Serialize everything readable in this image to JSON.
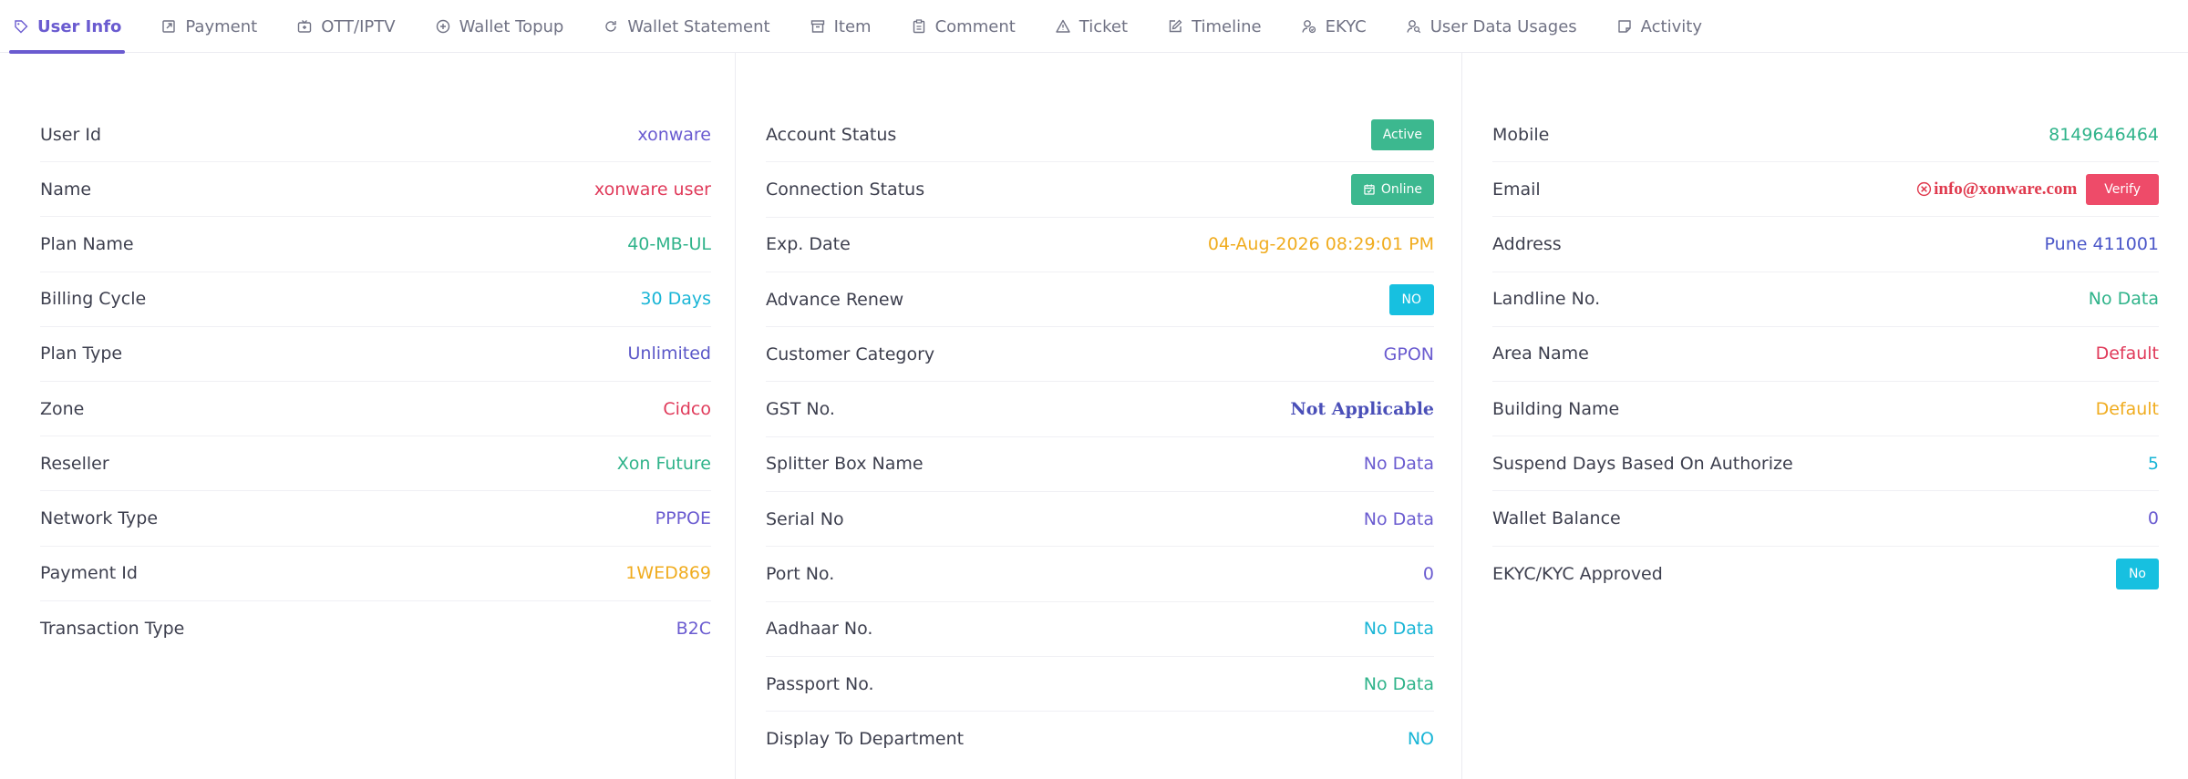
{
  "tabs": [
    {
      "label": "User Info",
      "icon": "tag-icon",
      "active": true
    },
    {
      "label": "Payment",
      "icon": "external-link-icon"
    },
    {
      "label": "OTT/IPTV",
      "icon": "tv-icon"
    },
    {
      "label": "Wallet Topup",
      "icon": "plus-circle-icon"
    },
    {
      "label": "Wallet Statement",
      "icon": "refresh-icon"
    },
    {
      "label": "Item",
      "icon": "archive-icon"
    },
    {
      "label": "Comment",
      "icon": "clipboard-icon"
    },
    {
      "label": "Ticket",
      "icon": "alert-triangle-icon"
    },
    {
      "label": "Timeline",
      "icon": "edit-icon"
    },
    {
      "label": "EKYC",
      "icon": "user-check-icon"
    },
    {
      "label": "User Data Usages",
      "icon": "user-search-icon"
    },
    {
      "label": "Activity",
      "icon": "note-icon"
    }
  ],
  "col1": [
    {
      "label": "User Id",
      "value": "xonware",
      "color": "#6a5bd0"
    },
    {
      "label": "Name",
      "value": "xonware user",
      "color": "#e03a5a"
    },
    {
      "label": "Plan Name",
      "value": "40-MB-UL",
      "color": "#2fb38a"
    },
    {
      "label": "Billing Cycle",
      "value": "30 Days",
      "color": "#19b5d6"
    },
    {
      "label": "Plan Type",
      "value": "Unlimited",
      "color": "#5b57c8"
    },
    {
      "label": "Zone",
      "value": "Cidco",
      "color": "#e03a5a"
    },
    {
      "label": "Reseller",
      "value": "Xon Future",
      "color": "#2fb38a"
    },
    {
      "label": "Network Type",
      "value": "PPPOE",
      "color": "#6a5bd0"
    },
    {
      "label": "Payment Id",
      "value": "1WED869",
      "color": "#f0ac1f"
    },
    {
      "label": "Transaction Type",
      "value": "B2C",
      "color": "#6a5bd0"
    }
  ],
  "col2": [
    {
      "label": "Account Status",
      "badge": "Active",
      "badge_class": "green"
    },
    {
      "label": "Connection Status",
      "badge": "Online",
      "badge_class": "green",
      "badge_icon": "calendar-check-icon"
    },
    {
      "label": "Exp. Date",
      "value": "04-Aug-2026 08:29:01 PM",
      "color": "#f0ac1f"
    },
    {
      "label": "Advance Renew",
      "badge": "NO",
      "badge_class": "cyan"
    },
    {
      "label": "Customer Category",
      "value": "GPON",
      "color": "#6a5bd0"
    },
    {
      "label": "GST No.",
      "value": "Not Applicable",
      "color": "#4a4fb8",
      "serif": true
    },
    {
      "label": "Splitter Box Name",
      "value": "No Data",
      "color": "#6a5bd0"
    },
    {
      "label": "Serial No",
      "value": "No Data",
      "color": "#6a5bd0"
    },
    {
      "label": "Port No.",
      "value": "0",
      "color": "#6a5bd0"
    },
    {
      "label": "Aadhaar No.",
      "value": "No Data",
      "color": "#19b5d6"
    },
    {
      "label": "Passport No.",
      "value": "No Data",
      "color": "#2fb38a"
    },
    {
      "label": "Display To Department",
      "value": "NO",
      "color": "#19b5d6"
    }
  ],
  "col3": [
    {
      "label": "Mobile",
      "value": "8149646464",
      "color": "#2fb38a"
    },
    {
      "label": "Email",
      "email": "info@xonware.com",
      "button": "Verify"
    },
    {
      "label": "Address",
      "value": "Pune 411001",
      "color": "#4a56c8"
    },
    {
      "label": "Landline No.",
      "value": "No Data",
      "color": "#2fb38a"
    },
    {
      "label": "Area Name",
      "value": "Default",
      "color": "#e03a5a"
    },
    {
      "label": "Building Name",
      "value": "Default",
      "color": "#f0ac1f"
    },
    {
      "label": "Suspend Days Based On Authorize",
      "value": "5",
      "color": "#19b5d6"
    },
    {
      "label": "Wallet Balance",
      "value": "0",
      "color": "#6a5bd0"
    },
    {
      "label": "EKYC/KYC Approved",
      "badge": "No",
      "badge_class": "cyan"
    }
  ]
}
